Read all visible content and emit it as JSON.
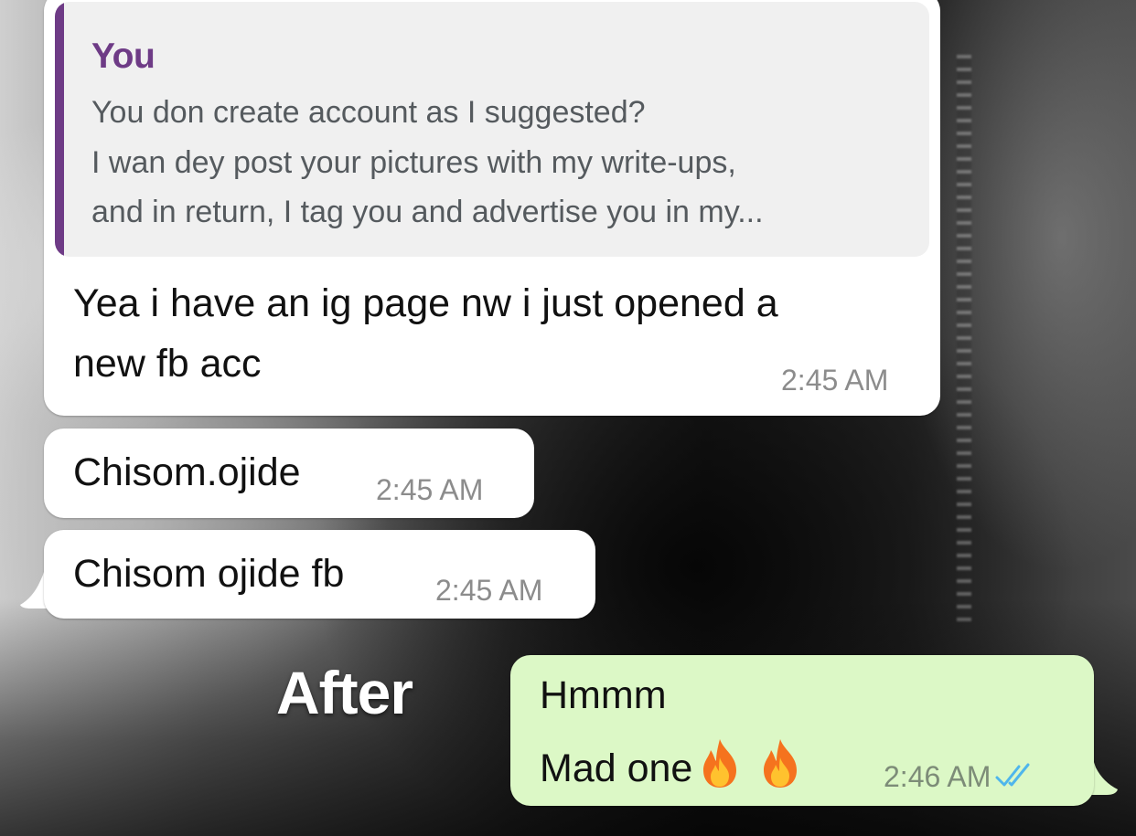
{
  "chat": {
    "messages": [
      {
        "direction": "incoming",
        "quote": {
          "author": "You",
          "lines": [
            "You don create account as I suggested?",
            "I wan dey post your pictures with my write-ups,",
            "and in return, I tag you and advertise you in my..."
          ]
        },
        "lines": [
          "Yea i have an ig page nw i just opened a",
          "new fb acc"
        ],
        "time": "2:45 AM"
      },
      {
        "direction": "incoming",
        "text": "Chisom.ojide",
        "time": "2:45 AM"
      },
      {
        "direction": "incoming",
        "text": "Chisom ojide fb",
        "time": "2:45 AM"
      },
      {
        "direction": "outgoing",
        "lines": [
          "Hmmm",
          "Mad one"
        ],
        "emoji": [
          "fire-icon",
          "fire-icon"
        ],
        "time": "2:46 AM",
        "status": "read-double-check-icon"
      }
    ]
  },
  "overlay": {
    "caption": "After"
  },
  "colors": {
    "incoming_bubble": "#ffffff",
    "outgoing_bubble": "#dcf8c6",
    "quote_accent": "#6e3b86",
    "read_ticks": "#4fb6ec"
  }
}
